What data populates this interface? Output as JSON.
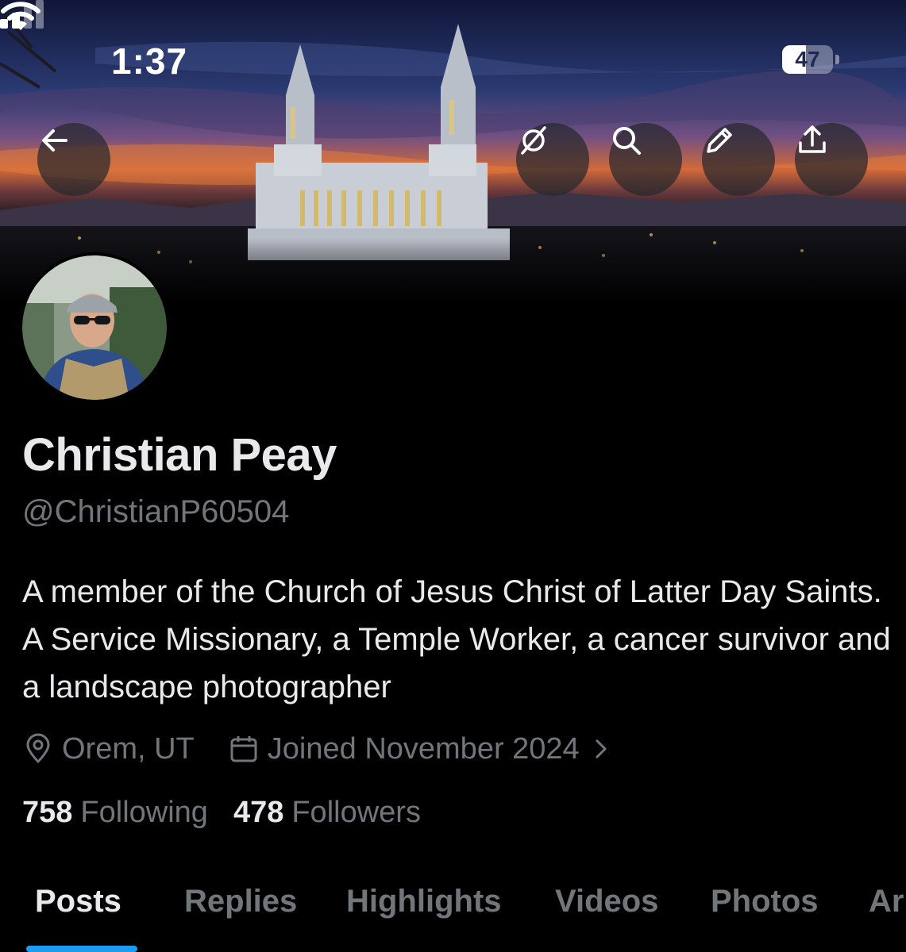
{
  "status_bar": {
    "time": "1:37",
    "battery_level": "47",
    "signal_bars_active": 2,
    "signal_bars_total": 4
  },
  "banner": {
    "description_icon": "temple-at-sunset-photo"
  },
  "header_actions": {
    "back_icon": "arrow-left-icon",
    "grok_icon": "grok-slash-icon",
    "search_icon": "search-icon",
    "edit_icon": "pencil-icon",
    "share_icon": "share-icon"
  },
  "profile": {
    "name": "Christian Peay",
    "handle": "@ChristianP60504",
    "bio": "A member of the Church of Jesus Christ of Latter Day Saints. A Service Missionary, a Temple Worker, a cancer survivor and a landscape photographer",
    "location": "Orem, UT",
    "joined": "Joined November 2024",
    "following_count": "758",
    "following_label": "Following",
    "followers_count": "478",
    "followers_label": "Followers"
  },
  "tabs": [
    {
      "label": "Posts",
      "active": true
    },
    {
      "label": "Replies",
      "active": false
    },
    {
      "label": "Highlights",
      "active": false
    },
    {
      "label": "Videos",
      "active": false
    },
    {
      "label": "Photos",
      "active": false
    },
    {
      "label": "Ar",
      "active": false
    }
  ],
  "colors": {
    "accent": "#1d9bf0",
    "background": "#000000",
    "primary_text": "#e7e9ea",
    "secondary_text": "#71767b"
  }
}
